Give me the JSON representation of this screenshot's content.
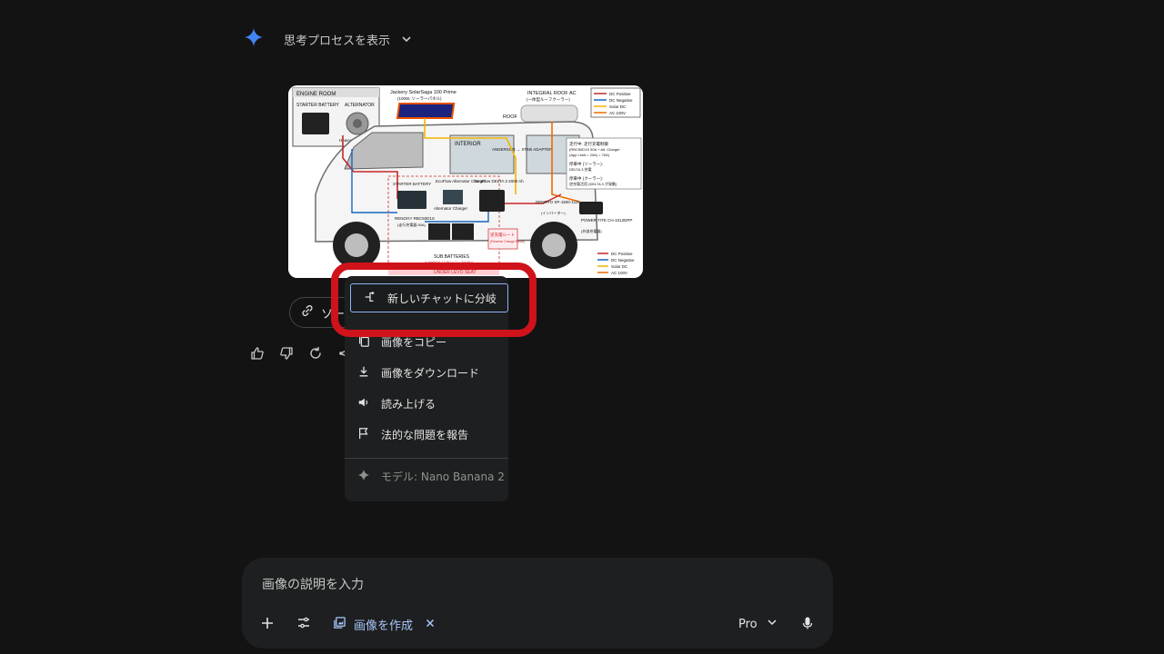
{
  "thinking": {
    "label": "思考プロセスを表示"
  },
  "source_chip": {
    "label": "ソー"
  },
  "menu": {
    "items": [
      {
        "label": "新しいチャットに分岐",
        "icon": "branch-icon"
      },
      {
        "label": "画像をコピー",
        "icon": "copy-icon"
      },
      {
        "label": "画像をダウンロード",
        "icon": "download-icon"
      },
      {
        "label": "読み上げる",
        "icon": "speaker-icon"
      },
      {
        "label": "法的な問題を報告",
        "icon": "flag-icon"
      }
    ],
    "model_label": "モデル: Nano Banana 2"
  },
  "prompt": {
    "placeholder": "画像の説明を入力",
    "create_image_label": "画像を作成",
    "model_select": "Pro"
  },
  "diagram": {
    "engine_room": "ENGINE ROOM",
    "starter_battery": "STARTER BATTERY",
    "alternator": "ALTERNATOR",
    "heavy_dc": "Heavy DC Cable",
    "solar_title": "Jackery SolarSaga 100 Prime",
    "solar_sub": "(100W, ソーラーパネル)",
    "roof": "ROOF",
    "roof_ac": "INTEGRAL ROOF AC",
    "roof_ac_sub": "(一体型ルーフクーラー)",
    "interior": "INTERIOR",
    "anderson": "ANDERSON → XT60i ADAPTER",
    "starter_battery2": "STARTER BATTERY",
    "renogy": "RENOGY RBC50D1S",
    "renogy_sub": "(走行充電器 50A)",
    "ecoflow_alt": "EcoFlow Alternator Charger",
    "ecoflow_delta": "EcoFlow DELTA 3 2000 Ah",
    "alt_charger": "Alternator Charger",
    "reverse_charge": "逆充電ルート",
    "reverse_charge_sub": "(Reverse Charge Route)",
    "sub_batteries": "SUB BATTERIES",
    "sub_batteries_sub": "(LiFePO4 12.8V × 2 = 200Ah)",
    "under_seat": "UNDER LEVO SEAT",
    "denryo": "DENRYO SP-1500-112A",
    "denryo_sub": "(インバーター)",
    "power_tite": "POWER TITE CH-1012DPP",
    "power_tite_sub": "(外部充電器)",
    "legend": [
      {
        "name": "DC Positive",
        "color": "#c62828"
      },
      {
        "name": "DC Negative",
        "color": "#1565c0"
      },
      {
        "name": "Solar DC",
        "color": "#f4b400"
      },
      {
        "name": "AC 100V",
        "color": "#ef6c00"
      }
    ],
    "note1": "走行中: 走行充電制御",
    "note1b": "(RBC50D1S 50A + Alt. Charger",
    "note1c": "(App Limit = 20A) = 70A)",
    "note2": "停車中 (ソーラー):",
    "note2b": "DELTA 3 充電",
    "note3": "停車中 (クーラー):",
    "note3b": "逆充電活用 (DELTA 3 が発動)"
  }
}
